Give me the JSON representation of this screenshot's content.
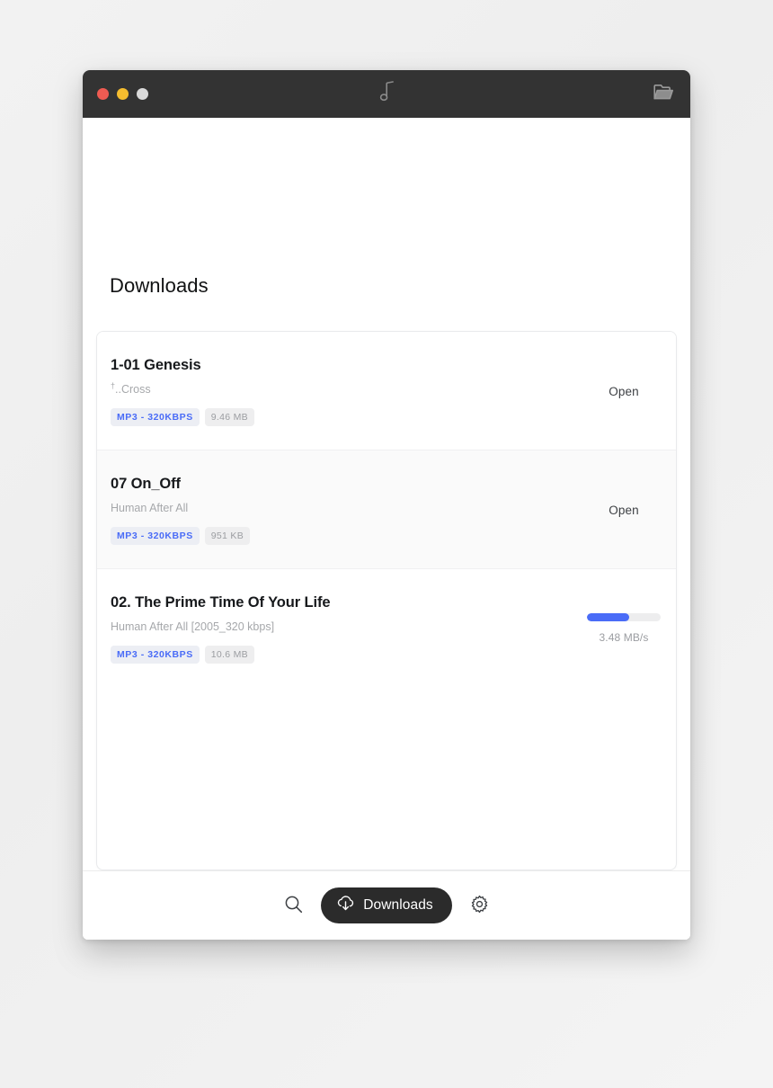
{
  "window": {
    "titlebar": {
      "traffic_lights": [
        {
          "name": "close",
          "color": "#ef5b52"
        },
        {
          "name": "minimize",
          "color": "#f5bd2f"
        },
        {
          "name": "maximize",
          "color": "#d9d9d9"
        }
      ],
      "center_icon": "music-note-icon",
      "right_icon": "open-folder-icon"
    }
  },
  "page": {
    "title": "Downloads"
  },
  "downloads": [
    {
      "title": "1-01 Genesis",
      "artist": "†..Cross",
      "format_badge": "MP3 - 320KBPS",
      "size_badge": "9.46 MB",
      "action_label": "Open",
      "state": "complete"
    },
    {
      "title": "07 On_Off",
      "artist": "Human After All",
      "format_badge": "MP3 - 320KBPS",
      "size_badge": "951 KB",
      "action_label": "Open",
      "state": "complete"
    },
    {
      "title": "02. The Prime Time Of Your Life",
      "artist": "Human After All [2005_320 kbps]",
      "format_badge": "MP3 - 320KBPS",
      "size_badge": "10.6 MB",
      "speed": "3.48 MB/s",
      "progress_percent": 57,
      "state": "downloading"
    }
  ],
  "footer": {
    "search_icon": "search-icon",
    "downloads_label": "Downloads",
    "downloads_icon": "cloud-download-icon",
    "settings_icon": "gear-icon"
  },
  "colors": {
    "accent": "#4a6cf7",
    "titlebar": "#333333",
    "pill": "#2b2b2b",
    "badge_format_bg": "#eceef4",
    "badge_size_bg": "#eeeeef"
  }
}
